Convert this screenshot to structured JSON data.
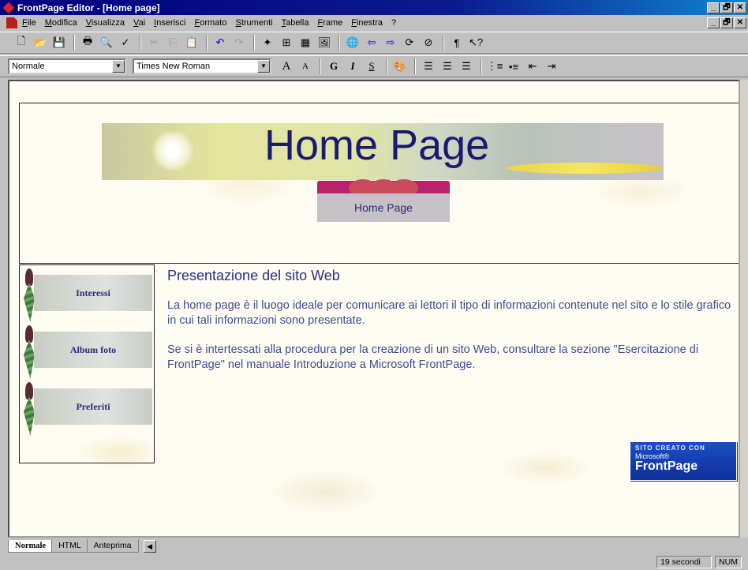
{
  "window": {
    "title": "FrontPage Editor - [Home page]",
    "buttons": [
      "_",
      "🗗",
      "✕"
    ]
  },
  "menu": {
    "items": [
      "File",
      "Modifica",
      "Visualizza",
      "Vai",
      "Inserisci",
      "Formato",
      "Strumenti",
      "Tabella",
      "Frame",
      "Finestra",
      "?"
    ],
    "mdi_buttons": [
      "_",
      "🗗",
      "✕"
    ]
  },
  "formatting": {
    "style_value": "Normale",
    "font_value": "Times New Roman"
  },
  "page": {
    "banner_title": "Home Page",
    "banner_subtitle": "Home Page",
    "nav": [
      "Interessi",
      "Album foto",
      "Preferiti"
    ],
    "heading": "Presentazione del sito Web",
    "para1": "La home page è il luogo ideale per comunicare ai lettori il tipo di informazioni contenute nel sito e lo stile grafico in cui tali informazioni sono presentate.",
    "para2": "Se si è intertessati alla procedura per la creazione di un sito Web, consultare la sezione \"Esercitazione di FrontPage\" nel manuale Introduzione a Microsoft FrontPage.",
    "badge": {
      "line1": "SITO CREATO CON",
      "line2": "Microsoft®",
      "line3": "FrontPage"
    }
  },
  "tabs": [
    "Normale",
    "HTML",
    "Anteprima"
  ],
  "status": {
    "time": "19 secondi",
    "num": "NUM"
  }
}
